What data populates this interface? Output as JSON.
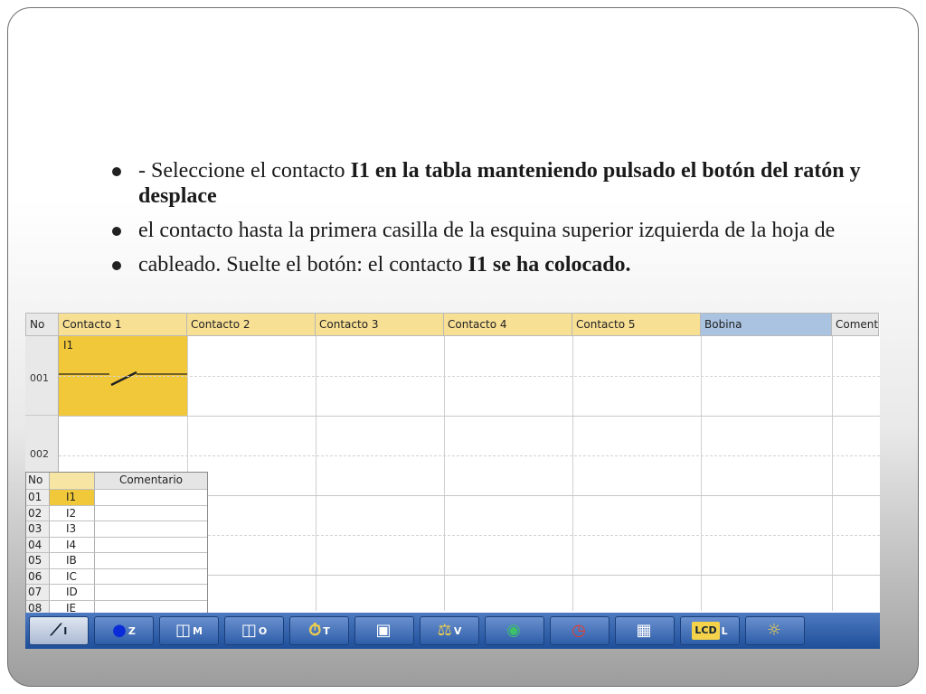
{
  "bullets": [
    {
      "plain": "- Seleccione el contacto ",
      "bold": "I1 en la tabla manteniendo pulsado el botón del ratón y desplace"
    },
    {
      "plain": "el contacto hasta la primera casilla de la esquina superior izquierda de la hoja de",
      "bold": ""
    },
    {
      "plain": "cableado. Suelte el botón: el contacto ",
      "bold": "I1 se ha colocado."
    }
  ],
  "ladder": {
    "headers": {
      "no": "No",
      "contacts": [
        "Contacto 1",
        "Contacto 2",
        "Contacto 3",
        "Contacto 4",
        "Contacto 5"
      ],
      "coil": "Bobina",
      "comment": "Comentario"
    },
    "rows": [
      "001",
      "002"
    ],
    "placed_contact": "I1"
  },
  "inputs_table": {
    "headers": {
      "no": "No",
      "contact": "",
      "comment": "Comentario"
    },
    "rows": [
      {
        "no": "01",
        "contact": "I1",
        "comment": ""
      },
      {
        "no": "02",
        "contact": "I2",
        "comment": ""
      },
      {
        "no": "03",
        "contact": "I3",
        "comment": ""
      },
      {
        "no": "04",
        "contact": "I4",
        "comment": ""
      },
      {
        "no": "05",
        "contact": "IB",
        "comment": ""
      },
      {
        "no": "06",
        "contact": "IC",
        "comment": ""
      },
      {
        "no": "07",
        "contact": "ID",
        "comment": ""
      },
      {
        "no": "08",
        "contact": "IE",
        "comment": ""
      }
    ]
  },
  "toolbar": [
    {
      "name": "contact-input-tool",
      "icon": "contact-icon",
      "glyph": "⟋",
      "label": "I"
    },
    {
      "name": "z-key-tool",
      "icon": "blue-circle-icon",
      "glyph": "●",
      "label": "Z"
    },
    {
      "name": "memory-tool",
      "icon": "relay-icon",
      "glyph": "◫",
      "label": "M"
    },
    {
      "name": "output-tool",
      "icon": "relay-icon",
      "glyph": "◫",
      "label": "O"
    },
    {
      "name": "timer-tool",
      "icon": "stopwatch-icon",
      "glyph": "⏱",
      "label": "T"
    },
    {
      "name": "counter-tool",
      "icon": "counter-icon",
      "glyph": "▣",
      "label": ""
    },
    {
      "name": "comparator-tool",
      "icon": "scale-icon",
      "glyph": "⚖",
      "label": "V"
    },
    {
      "name": "analog-tool",
      "icon": "analog-display-icon",
      "glyph": "◉",
      "label": ""
    },
    {
      "name": "clock-tool",
      "icon": "clock-icon",
      "glyph": "◷",
      "label": ""
    },
    {
      "name": "text-tool",
      "icon": "grid-icon",
      "glyph": "▦",
      "label": ""
    },
    {
      "name": "lcd-tool",
      "icon": "lcd-icon",
      "glyph": "LCD",
      "label": "L"
    },
    {
      "name": "sun-tool",
      "icon": "sun-icon",
      "glyph": "☼",
      "label": ""
    }
  ]
}
